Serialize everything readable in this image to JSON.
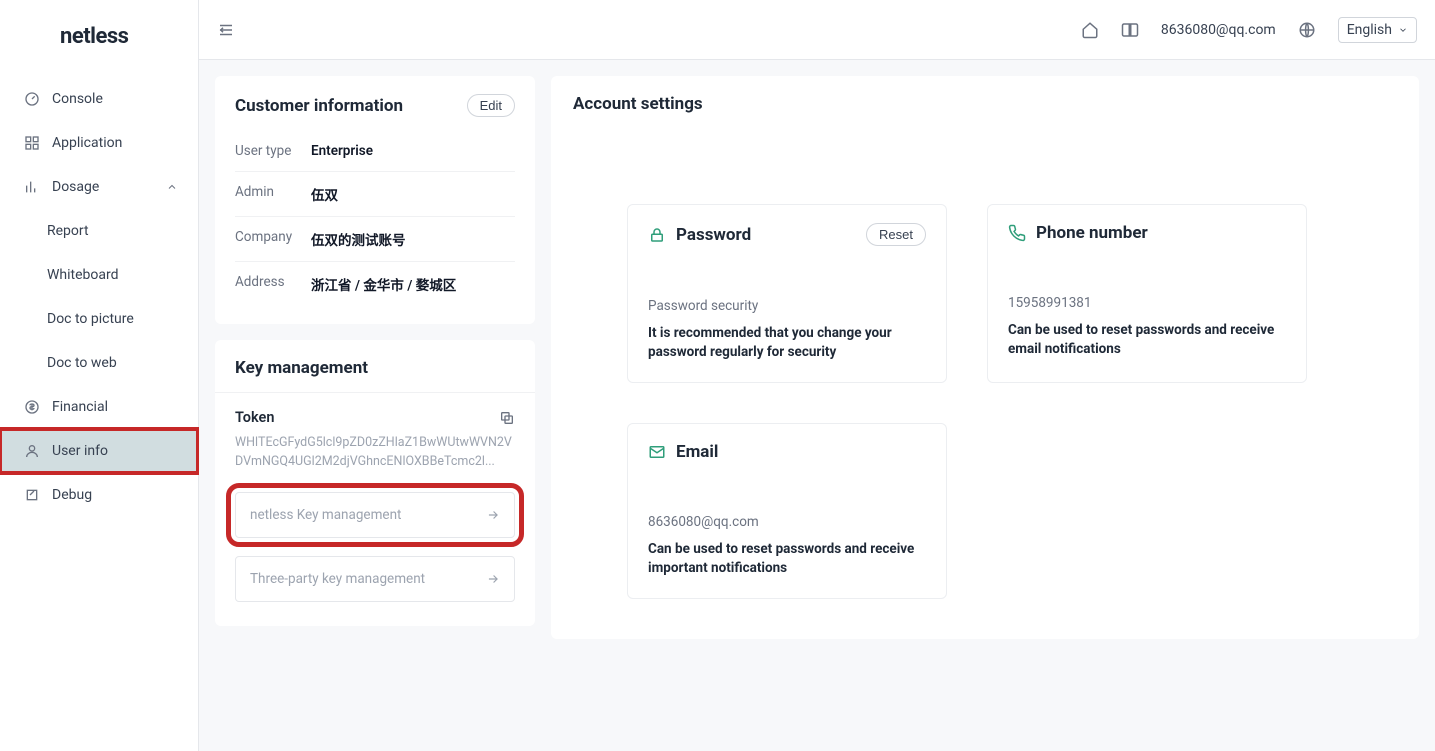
{
  "brand": "netless",
  "header": {
    "user_email": "8636080@qq.com",
    "language": "English"
  },
  "sidebar": {
    "items": [
      {
        "label": "Console"
      },
      {
        "label": "Application"
      },
      {
        "label": "Dosage"
      },
      {
        "label": "Report"
      },
      {
        "label": "Whiteboard"
      },
      {
        "label": "Doc to picture"
      },
      {
        "label": "Doc to web"
      },
      {
        "label": "Financial"
      },
      {
        "label": "User info"
      },
      {
        "label": "Debug"
      }
    ]
  },
  "customer_info": {
    "title": "Customer information",
    "edit_label": "Edit",
    "rows": {
      "user_type_label": "User type",
      "user_type_value": "Enterprise",
      "admin_label": "Admin",
      "admin_value": "伍双",
      "company_label": "Company",
      "company_value": "伍双的测试账号",
      "address_label": "Address",
      "address_value": "浙江省 / 金华市 / 婺城区"
    }
  },
  "key_mgmt": {
    "title": "Key management",
    "token_label": "Token",
    "token_value": "WHlTEcGFydG5lcl9pZD0zZHlaZ1BwWUtwWVN2VDVmNGQ4UGl2M2djVGhncENlOXBBeTcmc2l...",
    "netless_link": "netless Key management",
    "thirdparty_link": "Three-party key management"
  },
  "account": {
    "title": "Account settings",
    "password": {
      "title": "Password",
      "reset_label": "Reset",
      "value": "Password security",
      "desc": "It is recommended that you change your password regularly for security"
    },
    "phone": {
      "title": "Phone number",
      "value": "15958991381",
      "desc": "Can be used to reset passwords and receive email notifications"
    },
    "email": {
      "title": "Email",
      "value": "8636080@qq.com",
      "desc": "Can be used to reset passwords and receive important notifications"
    }
  }
}
